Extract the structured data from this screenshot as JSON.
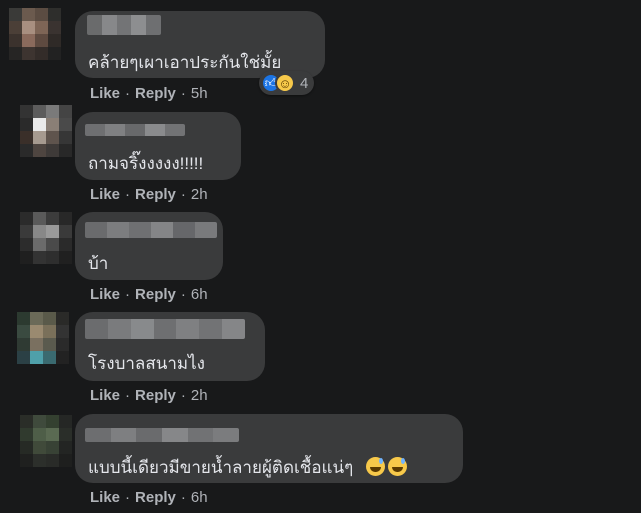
{
  "colors": {
    "background": "#18191a",
    "bubble": "#3a3b3c",
    "text": "#e4e6eb",
    "secondary_text": "#b0b3b8",
    "like_blue": "#1b74e4",
    "haha_yellow": "#f7c94a"
  },
  "actions": {
    "like": "Like",
    "reply": "Reply",
    "separator": "·"
  },
  "comments": [
    {
      "text": "คล้ายๆเผาเอาประกันใช่มั้ย",
      "time": "5h",
      "reactions": {
        "icons": [
          "like-icon",
          "haha-icon"
        ],
        "count": "4"
      }
    },
    {
      "text": "ถามจริ๊งงงงง!!!!!",
      "time": "2h"
    },
    {
      "text": "บ้า",
      "time": "6h"
    },
    {
      "text": "โรงบาลสนามไง",
      "time": "2h"
    },
    {
      "text": "แบบนี้เดียวมีขายน้ำลายผู้ติดเชื้อแน่ๆ",
      "emoji": [
        "sweat-smile-emoji",
        "sweat-smile-emoji"
      ],
      "time": "6h"
    }
  ]
}
